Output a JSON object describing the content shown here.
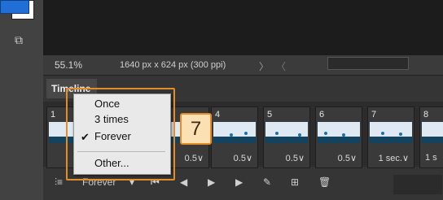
{
  "status": {
    "zoom": "55.1%",
    "doc_info": "1640 px x 624 px (300 ppi)",
    "arrow": "〉",
    "lt": "〈"
  },
  "timeline": {
    "tab_label": "Timeline",
    "frames": [
      {
        "num": "1",
        "delay": ""
      },
      {
        "num": "4",
        "delay": "0.5∨"
      },
      {
        "num": "5",
        "delay": "0.5∨"
      },
      {
        "num": "6",
        "delay": "0.5∨"
      },
      {
        "num": "7",
        "delay": "1 sec.∨"
      },
      {
        "num": "8",
        "delay": "1 s"
      }
    ],
    "hidden_delay": "0.5∨",
    "loop_value": "Forever"
  },
  "loop_menu": {
    "items": [
      "Once",
      "3 times",
      "Forever",
      "Other..."
    ],
    "checked": "Forever",
    "check_glyph": "✔"
  },
  "callout": {
    "label": "7"
  },
  "icons": {
    "convert": "⫶≡",
    "dropdown": "▾",
    "first_frame": "⏮",
    "prev_frame": "◀︎",
    "play": "▶︎",
    "next_frame": "▶︎",
    "tween": "✎",
    "duplicate": "⊞",
    "delete": "🗑"
  },
  "colors": {
    "accent_orange": "#e38d2a",
    "callout_fill": "#fbe0b3",
    "swatch_front": "#1f6fd6"
  }
}
